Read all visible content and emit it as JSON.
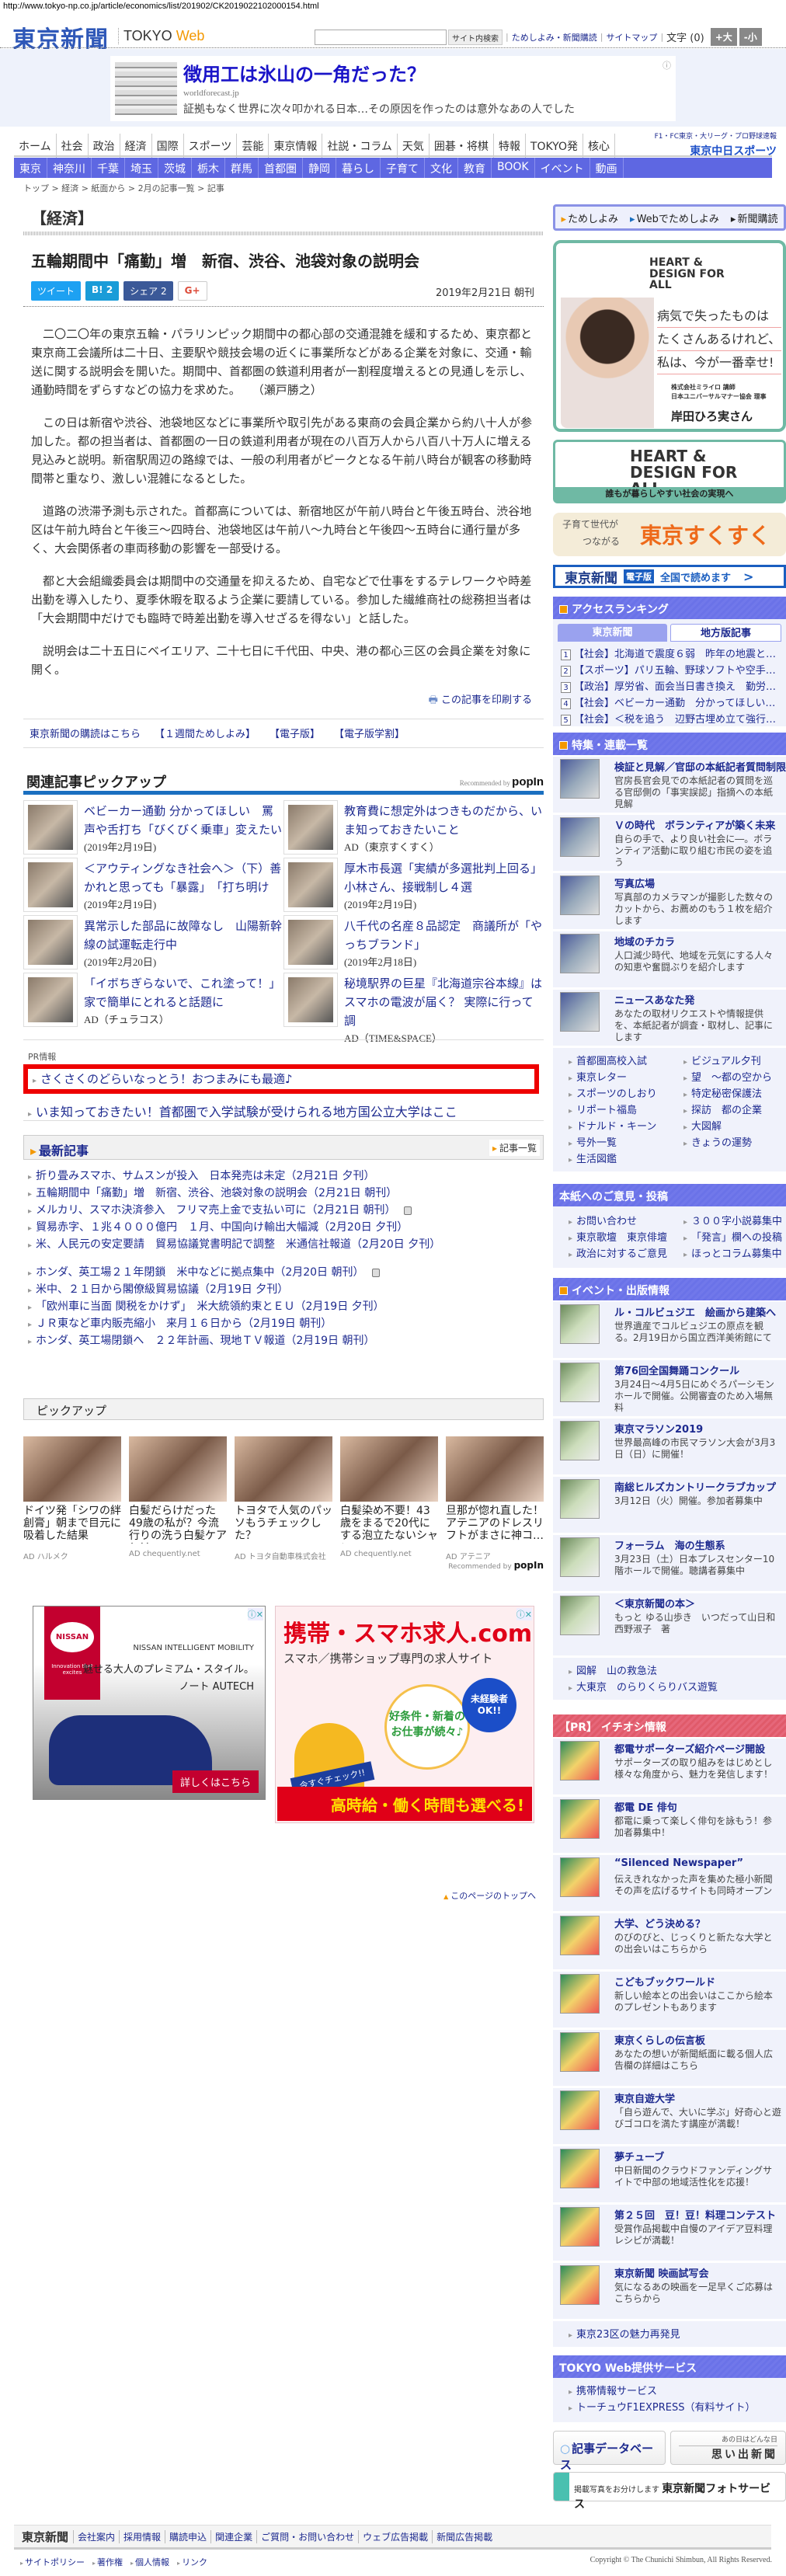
{
  "browser": {
    "url": "http://www.tokyo-np.co.jp/article/economics/list/201902/CK2019022102000154.html"
  },
  "header": {
    "logo": "東京新聞",
    "logo_sub_1": "TOKYO",
    "logo_sub_2": "Web",
    "search_button": "サイト内検索",
    "links": [
      "ためしよみ・新聞購読",
      "サイトマップ"
    ],
    "font_label": "文字 (0)",
    "font_up": "+大",
    "font_down": "-小"
  },
  "top_ad": {
    "title": "徴用工は氷山の一角だった？",
    "domain": "worldforecast.jp",
    "text": "証拠もなく世界に次々叩かれる日本…その原因を作ったのは意外なあの人でした"
  },
  "nav": {
    "main": [
      "ホーム",
      "社会",
      "政治",
      "経済",
      "国際",
      "スポーツ",
      "芸能",
      "東京情報",
      "社説・コラム",
      "天気",
      "囲碁・将棋",
      "特報",
      "TOKYO発",
      "核心"
    ],
    "side_text": "F1・FC東京・大リーグ・プロ野球速報",
    "side_link": "東京中日スポーツ",
    "sub": [
      "東京",
      "神奈川",
      "千葉",
      "埼玉",
      "茨城",
      "栃木",
      "群馬",
      "首都圏",
      "静岡",
      "暮らし",
      "子育て",
      "文化",
      "教育",
      "BOOK",
      "イベント",
      "動画"
    ]
  },
  "breadcrumb": "トップ > 経済 > 紙面から > 2月の記事一覧 > 記事",
  "article": {
    "category": "【経済】",
    "title": "五輪期間中「痛勤」増　新宿、渋谷、池袋対象の説明会",
    "share": {
      "tweet": "ツイート",
      "hatena": "B! 2",
      "facebook": "シェア 2",
      "gplus": "G+"
    },
    "date": "2019年2月21日 朝刊",
    "paragraphs": [
      "二〇二〇年の東京五輪・パラリンピック期間中の都心部の交通混雑を緩和するため、東京都と東京商工会議所は二十日、主要駅や競技会場の近くに事業所などがある企業を対象に、交通・輸送に関する説明会を開いた。期間中、首都圏の鉄道利用者が一割程度増えるとの見通しを示し、通勤時間をずらすなどの協力を求めた。　　（瀬戸勝之）",
      "この日は新宿や渋谷、池袋地区などに事業所や取引先がある東商の会員企業から約八十人が参加した。都の担当者は、首都圏の一日の鉄道利用者が現在の八百万人から八百八十万人に増える見込みと説明。新宿駅周辺の路線では、一般の利用者がピークとなる午前八時台が観客の移動時間帯と重なり、激しい混雑になるとした。",
      "道路の渋滞予測も示された。首都高については、新宿地区が午前八時台と午後五時台、渋谷地区は午前九時台と午後三～四時台、池袋地区は午前八～九時台と午後四～五時台に通行量が多く、大会関係者の車両移動の影響を一部受ける。",
      "都と大会組織委員会は期間中の交通量を抑えるため、自宅などで仕事をするテレワークや時差出勤を導入したり、夏季休暇を取るよう企業に要請している。参加した繊維商社の総務担当者は「大会期間中だけでも臨時で時差出勤を導入せざるを得ない」と話した。",
      "説明会は二十五日にベイエリア、二十七日に千代田、中央、港の都心三区の会員企業を対象に開く。"
    ],
    "print": "この記事を印刷する",
    "sub_links": [
      "東京新聞の購読はこちら",
      "【１週間ためしよみ】",
      "【電子版】",
      "【電子版学割】"
    ]
  },
  "related": {
    "heading": "関連記事ピックアップ",
    "rec_by": "Recommended by",
    "rec_brand": "popIn",
    "items": [
      {
        "title": "ベビーカー通勤 分かってほしい　罵声や舌打ち「びくびく乗車」変えたい",
        "meta": "(2019年2月19日)"
      },
      {
        "title": "教育費に想定外はつきものだから、いま知っておきたいこと",
        "meta": "AD（東京すくすく）"
      },
      {
        "title": "＜アウティングなき社会へ＞（下）善かれと思っても「暴露」　「打ち明け",
        "meta": "(2019年2月19日)"
      },
      {
        "title": "厚木市長選「実績が多選批判上回る」　小林さん、接戦制し４選",
        "meta": "(2019年2月19日)"
      },
      {
        "title": "異常示した部品に故障なし　山陽新幹線の試運転走行中",
        "meta": "(2019年2月20日)"
      },
      {
        "title": "八千代の名産８品認定　商議所が「やっちブランド」",
        "meta": "(2019年2月18日)"
      },
      {
        "title": "「イボちぎらないで、これ塗って！」家で簡単にとれると話題に",
        "meta": "AD（チュラコス）"
      },
      {
        "title": "秘境駅界の巨星『北海道宗谷本線』はスマホの電波が届く？ 実際に行って調",
        "meta": "AD（TIME&SPACE）"
      }
    ]
  },
  "pr": {
    "label": "PR情報",
    "items": [
      "さくさくのどらいなっとう！おつまみにも最適♪",
      "いま知っておきたい！首都圏で入学試験が受けられる地方国公立大学はここ"
    ]
  },
  "latest": {
    "heading": "最新記事",
    "list_link": "記事一覧",
    "items": [
      "折り畳みスマホ、サムスンが投入　日本発売は未定（2月21日 夕刊）",
      "五輪期間中「痛勤」増　新宿、渋谷、池袋対象の説明会（2月21日 朝刊）",
      "メルカリ、スマホ決済参入　フリマ売上金で支払い可に（2月21日 朝刊）",
      "貿易赤字、１兆４０００億円　１月、中国向け輸出大幅減（2月20日 夕刊）",
      "米、人民元の安定要請　貿易協議覚書明記で調整　米通信社報道（2月20日 夕刊）",
      "ホンダ、英工場２１年閉鎖　米中などに拠点集中（2月20日 朝刊）",
      "米中、２１日から閣僚級貿易協議（2月19日 夕刊）",
      "「欧州車に当面 関税をかけず」　米大統領約束とＥＵ（2月19日 夕刊）",
      "ＪＲ東など車内販売縮小　来月１６日から（2月19日 朝刊）",
      "ホンダ、英工場閉鎖へ　２２年計画、現地ＴＶ報道（2月19日 朝刊）"
    ]
  },
  "pickup": {
    "heading": "ピックアップ",
    "rec_by": "Recommended by",
    "rec_brand": "popIn",
    "items": [
      {
        "title": "ドイツ発「シワの絆創膏」朝まで目元に吸着した結果",
        "source": "AD ハルメク"
      },
      {
        "title": "白髪だらけだった49歳の私が？今流行りの洗う白髪ケアとは",
        "source": "AD chequently.net"
      },
      {
        "title": "トヨタで人気のパッソもうチェックした？",
        "source": "AD トヨタ自動車株式会社"
      },
      {
        "title": "白髪染め不要！43歳をまるで20代にする泡立たないシャン…",
        "source": "AD chequently.net"
      },
      {
        "title": "旦那が惚れ直した！アテニアのドレスリフトがまさに神コ…",
        "source": "AD アテニア"
      }
    ]
  },
  "ad_nissan": {
    "brand": "NISSAN",
    "tagline": "Innovation that excites",
    "mobility": "NISSAN INTELLIGENT MOBILITY",
    "copy1": "魅せる大人のプレミアム・スタイル。",
    "copy2": "ノート AUTECH",
    "cta": "詳しくはこちら"
  },
  "ad_jobs": {
    "title": "携帯・スマホ求人.com",
    "sub": "スマホ／携帯ショップ専門の求人サイト",
    "bubble": "好条件・新着のお仕事が続々♪",
    "badge": "未経験者OK!!",
    "check": "今すぐチェック!!",
    "bottom": "高時給・働く時間も選べる!"
  },
  "page_top": "このページのトップへ",
  "sidebar": {
    "trial": [
      "ためしよみ",
      "Webでためしよみ",
      "新聞購読"
    ],
    "hdfa": {
      "logo": "HEART & DESIGN FOR ALL",
      "quote": [
        "病気で失ったものは",
        "たくさんあるけれど、",
        "私は、今が一番幸せ!"
      ],
      "role1": "株式会社ミライロ 講師",
      "role2": "日本ユニバーサルマナー協会 理事",
      "name": "岸田ひろ実さん"
    },
    "hdfa2": {
      "logo": "HEART & DESIGN FOR ALL",
      "tagline": "誰もが暮らしやすい社会の実現へ"
    },
    "sukusuku": {
      "a": "子育て世代が",
      "b": "つながる",
      "c": "東京すくすく"
    },
    "denshi": {
      "a": "東京新聞",
      "b": "電子版",
      "c": "全国で読めます"
    },
    "ranking": {
      "heading": "アクセスランキング",
      "tabs": [
        "東京新聞",
        "地方版記事"
      ],
      "items": [
        "【社会】北海道で震度６弱　昨年の地震と…",
        "【スポーツ】パリ五輪、野球ソフトや空手…",
        "【政治】厚労省、面会当日書き換え　勤労…",
        "【社会】ベビーカー通勤　分かってほしい…",
        "【社会】＜税を追う　辺野古埋め立て強行…"
      ]
    },
    "features": {
      "heading": "特集・連載一覧",
      "items": [
        {
          "title": "検証と見解／官邸の本紙記者質問制限",
          "desc": "官房長官会見での本紙記者の質問を巡る官邸側の「事実誤認」指摘への本紙見解"
        },
        {
          "title": "Ｖの時代　ボランティアが築く未来",
          "desc": "自らの手で、より良い社会に―。ボランティア活動に取り組む市民の姿を追う"
        },
        {
          "title": "写真広場",
          "desc": "写真部のカメラマンが撮影した数々のカットから、お薦めのもう１枚を紹介します"
        },
        {
          "title": "地域のチカラ",
          "desc": "人口減少時代、地域を元気にする人々の知恵や奮闘ぶりを紹介します"
        },
        {
          "title": "ニュースあなた発",
          "desc": "あなたの取材リクエストや情報提供を、本紙記者が調査・取材し、記事にします"
        }
      ],
      "links": [
        "首都圏高校入試",
        "ビジュアル夕刊",
        "東京レター",
        "望　～都の空から",
        "スポーツのしおり",
        "特定秘密保護法",
        "リポート福島",
        "探訪　都の企業",
        "ドナルド・キーン",
        "大図解",
        "号外一覧",
        "きょうの運勢",
        "生活図鑑"
      ]
    },
    "opinion": {
      "heading": "本紙へのご意見・投稿",
      "links": [
        "お問い合わせ",
        "３００字小説募集中",
        "東京歌壇　東京俳壇",
        "「発言」欄への投稿",
        "政治に対するご意見",
        "ほっとコラム募集中"
      ]
    },
    "events": {
      "heading": "イベント・出版情報",
      "items": [
        {
          "title": "ル・コルビュジエ　絵画から建築へ",
          "desc": "世界遺産でコルビュジエの原点を観る。2月19日から国立西洋美術館にて"
        },
        {
          "title": "第76回全国舞踊コンクール",
          "desc": "3月24日～4月5日にめぐろパーシモンホールで開催。公開審査のため入場無料"
        },
        {
          "title": "東京マラソン2019",
          "desc": "世界最高峰の市民マラソン大会が3月3日（日）に開催！"
        },
        {
          "title": "南総ヒルズカントリークラブカップ",
          "desc": "3月12日（火）開催。参加者募集中"
        },
        {
          "title": "フォーラム　海の生態系",
          "desc": "3月23日（土）日本プレスセンター10階ホールで開催。聴講者募集中"
        },
        {
          "title": "＜東京新聞の本＞",
          "desc": "もっと ゆる山歩き　いつだって山日和　西野淑子　著"
        }
      ],
      "links": [
        "図解　山の救急法",
        "大東京　のらりくらりバス遊覧"
      ]
    },
    "pr": {
      "heading": "【PR】 イチオシ情報",
      "items": [
        {
          "title": "都電サポーターズ紹介ページ開設",
          "desc": "サポーターズの取り組みをはじめとし様々な角度から、魅力を発信します！"
        },
        {
          "title": "都電 DE 俳句",
          "desc": "都電に乗って楽しく俳句を詠もう！参加者募集中！"
        },
        {
          "title": "“Silenced Newspaper”",
          "desc": "伝えきれなかった声を集めた極小新聞その声を広げるサイトも同時オープン"
        },
        {
          "title": "大学、どう決める？",
          "desc": "のびのびと、じっくりと新たな大学との出会いはこちらから"
        },
        {
          "title": "こどもブックワールド",
          "desc": "新しい絵本との出会いはここから絵本のプレゼントもあります"
        },
        {
          "title": "東京くらしの伝言板",
          "desc": "あなたの想いが新聞紙面に載る個人広告欄の詳細はこちら"
        },
        {
          "title": "東京自遊大学",
          "desc": "「自ら遊んで、大いに学ぶ」好奇心と遊びゴコロを満たす講座が満載！"
        },
        {
          "title": "夢チューブ",
          "desc": "中日新聞のクラウドファンディングサイトで中部の地域活性化を応援！"
        },
        {
          "title": "第２５回　豆！豆！料理コンテスト",
          "desc": "受賞作品掲載中自慢のアイデア豆料理レシピが満載！"
        },
        {
          "title": "東京新聞 映画試写会",
          "desc": "気になるあの映画を一足早くご応募はこちらから"
        }
      ],
      "links": [
        "東京23区の魅力再発見"
      ]
    },
    "services": {
      "heading": "TOKYO Web提供サービス",
      "links": [
        "携帯情報サービス",
        "トーチュウF1EXPRESS（有料サイト）"
      ]
    },
    "db_button": "記事データベース",
    "omoide_small": "あの日はどんな日",
    "omoide": "思い出新聞",
    "photo_small": "掲載写真をお分けします",
    "photo": "東京新聞フォトサービス"
  },
  "footer": {
    "logo": "東京新聞",
    "links": [
      "会社案内",
      "採用情報",
      "購読申込",
      "関連企業",
      "ご質問・お問い合わせ",
      "ウェブ広告掲載",
      "新聞広告掲載"
    ],
    "bottom": [
      "サイトポリシー",
      "著作権",
      "個人情報",
      "リンク"
    ],
    "copyright": "Copyright © The Chunichi Shimbun, All Rights Reserved."
  },
  "colors": {
    "nav_blue": "#5e67e2",
    "side_header": "#6a72e8",
    "pr_header": "#e05a6a",
    "link": "#1d2a8f",
    "highlight": "#ee0000"
  }
}
